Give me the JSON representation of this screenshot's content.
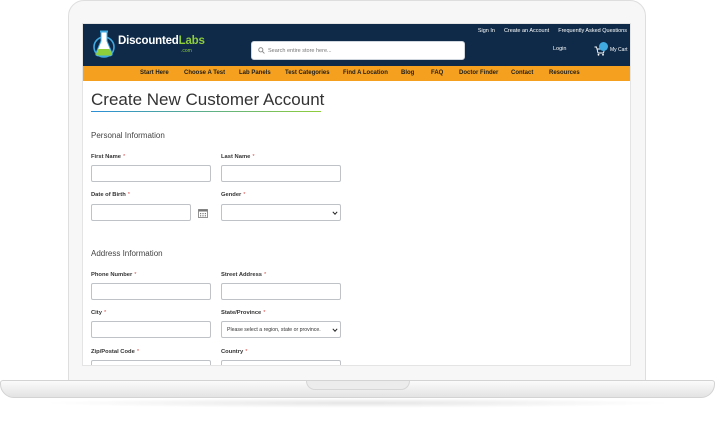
{
  "brand": {
    "name_a": "Discounted",
    "name_b": "Labs",
    "domain_suffix": ".com"
  },
  "search": {
    "placeholder": "Search entire store here..."
  },
  "toplinks": [
    "Sign In",
    "Create an Account",
    "Frequently Asked Questions"
  ],
  "account": {
    "login_label": "Login",
    "cart_label": "My Cart"
  },
  "nav": [
    "Start Here",
    "Choose A Test",
    "Lab Panels",
    "Test Categories",
    "Find A Location",
    "Blog",
    "FAQ",
    "Doctor Finder",
    "Contact",
    "Resources"
  ],
  "page": {
    "title": "Create New Customer Account"
  },
  "personal": {
    "heading": "Personal Information",
    "first_name": "First Name",
    "last_name": "Last Name",
    "dob": "Date of Birth",
    "gender": "Gender",
    "required_mark": "*"
  },
  "address": {
    "heading": "Address Information",
    "phone": "Phone Number",
    "street": "Street Address",
    "city": "City",
    "state": "State/Province",
    "state_placeholder": "Please select a region, state or province.",
    "zip": "Zip/Postal Code",
    "country": "Country"
  },
  "colors": {
    "header_bg": "#0e2a48",
    "nav_bg": "#f5a11f",
    "brand_green": "#8fce3b",
    "accent_blue": "#3fa9e0",
    "required": "#d9534f"
  },
  "icons": [
    "flask-logo-icon",
    "search-icon",
    "cart-icon",
    "calendar-icon",
    "chevron-down-icon"
  ]
}
